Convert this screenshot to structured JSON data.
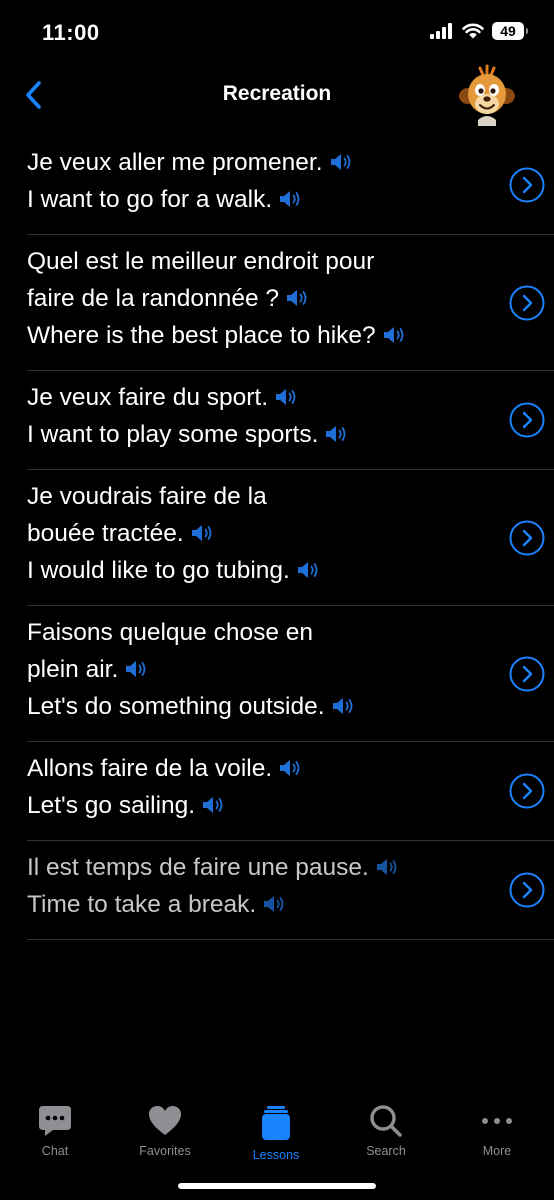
{
  "status_bar": {
    "time": "11:00",
    "battery": "49"
  },
  "nav": {
    "title": "Recreation"
  },
  "colors": {
    "accent": "#1a84ff",
    "background": "#000000",
    "separator": "#333333",
    "inactive": "#8e8e93"
  },
  "phrases": [
    {
      "fr": [
        "Je veux aller me promener."
      ],
      "en": "I want to go for a walk."
    },
    {
      "fr": [
        "Quel est le meilleur endroit pour",
        "faire de la randonnée ?"
      ],
      "en": "Where is the best place to hike?"
    },
    {
      "fr": [
        "Je veux faire du sport."
      ],
      "en": "I want to play some sports."
    },
    {
      "fr": [
        "Je voudrais faire de la",
        "bouée tractée."
      ],
      "en": "I would like to go tubing."
    },
    {
      "fr": [
        "Faisons quelque chose en",
        "plein air."
      ],
      "en": "Let's do something outside."
    },
    {
      "fr": [
        "Allons faire de la voile."
      ],
      "en": "Let's go sailing."
    },
    {
      "fr": [
        "Il est temps de faire une pause."
      ],
      "en": "Time to take a break."
    }
  ],
  "tabs": [
    {
      "label": "Chat",
      "icon": "chat-icon"
    },
    {
      "label": "Favorites",
      "icon": "heart-icon"
    },
    {
      "label": "Lessons",
      "icon": "lessons-icon",
      "active": true
    },
    {
      "label": "Search",
      "icon": "search-icon"
    },
    {
      "label": "More",
      "icon": "more-icon"
    }
  ]
}
